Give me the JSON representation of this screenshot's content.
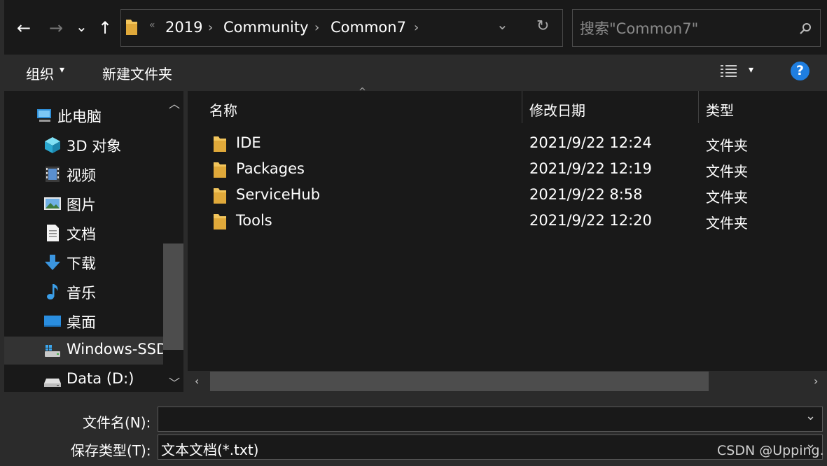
{
  "nav": {
    "back": "←",
    "forward": "→",
    "recent": "⌄",
    "up": "↑",
    "overflow": "«",
    "breadcrumb": [
      "2019",
      "Community",
      "Common7"
    ],
    "separator": "›",
    "dropdown": "⌄",
    "refresh": "↻",
    "search_placeholder": "搜索\"Common7\""
  },
  "toolbar": {
    "organize": "组织",
    "organize_caret": "▾",
    "new_folder": "新建文件夹",
    "view_caret": "▾",
    "help": "?"
  },
  "sidebar": {
    "items": [
      {
        "label": "此电脑",
        "icon": "computer-icon"
      },
      {
        "label": "3D 对象",
        "icon": "3d-objects-icon"
      },
      {
        "label": "视频",
        "icon": "video-icon"
      },
      {
        "label": "图片",
        "icon": "pictures-icon"
      },
      {
        "label": "文档",
        "icon": "documents-icon"
      },
      {
        "label": "下载",
        "icon": "download-icon"
      },
      {
        "label": "音乐",
        "icon": "music-icon"
      },
      {
        "label": "桌面",
        "icon": "desktop-icon"
      },
      {
        "label": "Windows-SSD",
        "icon": "windows-drive-icon"
      },
      {
        "label": "Data (D:)",
        "icon": "drive-icon"
      }
    ],
    "selected": "Windows-SSD"
  },
  "columns": {
    "name": "名称",
    "date": "修改日期",
    "type": "类型"
  },
  "files": [
    {
      "name": "IDE",
      "date": "2021/9/22 12:24",
      "type": "文件夹"
    },
    {
      "name": "Packages",
      "date": "2021/9/22 12:19",
      "type": "文件夹"
    },
    {
      "name": "ServiceHub",
      "date": "2021/9/22 8:58",
      "type": "文件夹"
    },
    {
      "name": "Tools",
      "date": "2021/9/22 12:20",
      "type": "文件夹"
    }
  ],
  "bottom": {
    "filename_label": "文件名(N):",
    "filename_value": "",
    "filetype_label": "保存类型(T):",
    "filetype_value": "文本文档(*.txt)",
    "caret": "⌄"
  },
  "watermark": "CSDN @Upping.",
  "colors": {
    "background": "#191919",
    "panel": "#2b2b2b",
    "folder": "#f2c55c",
    "help": "#1f7ee0"
  }
}
